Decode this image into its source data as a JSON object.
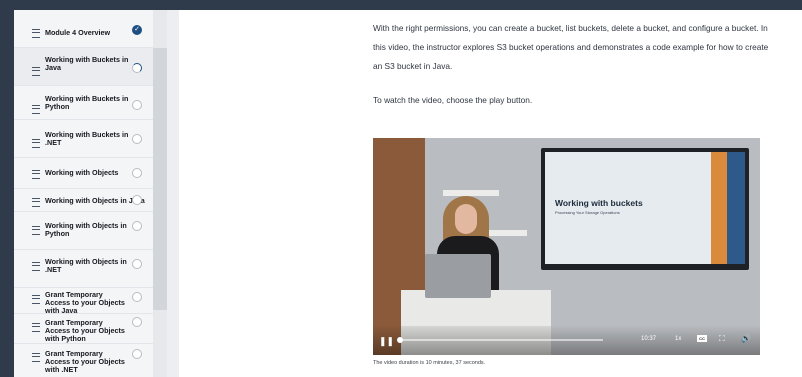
{
  "sidebar": {
    "items": [
      {
        "label": "Module 4 Overview",
        "status": "done"
      },
      {
        "label": "Working with Buckets in Java",
        "status": "progress"
      },
      {
        "label": "Working with Buckets in Python",
        "status": "todo"
      },
      {
        "label": "Working with Buckets in .NET",
        "status": "todo"
      },
      {
        "label": "Working with Objects",
        "status": "todo"
      },
      {
        "label": "Working with Objects in Java",
        "status": "todo"
      },
      {
        "label": "Working with Objects in Python",
        "status": "todo"
      },
      {
        "label": "Working with Objects in .NET",
        "status": "todo"
      },
      {
        "label": "Grant Temporary Access to your Objects with Java",
        "status": "todo"
      },
      {
        "label": "Grant Temporary Access to your Objects with Python",
        "status": "todo"
      },
      {
        "label": "Grant Temporary Access to your Objects with .NET",
        "status": "todo"
      }
    ]
  },
  "main": {
    "paragraph1": "With the right permissions, you can create a bucket, list buckets, delete a bucket, and configure a bucket. In this video, the instructor explores S3 bucket operations and demonstrates a code example for how to create an S3 bucket in Java.",
    "paragraph2": "To watch the video, choose the play button.",
    "video": {
      "slide_title": "Working with buckets",
      "slide_subtitle": "Processing Your Storage Operations",
      "play_icon": "pause-icon",
      "time": "10:37",
      "speed": "1x",
      "cc_label": "CC",
      "fullscreen_icon": "fullscreen-icon",
      "volume_icon": "volume-icon"
    },
    "caption": "The video duration is 10 minutes, 37 seconds."
  },
  "colors": {
    "accent": "#1f4f82",
    "sidebar_bg": "#f4f5f7"
  }
}
